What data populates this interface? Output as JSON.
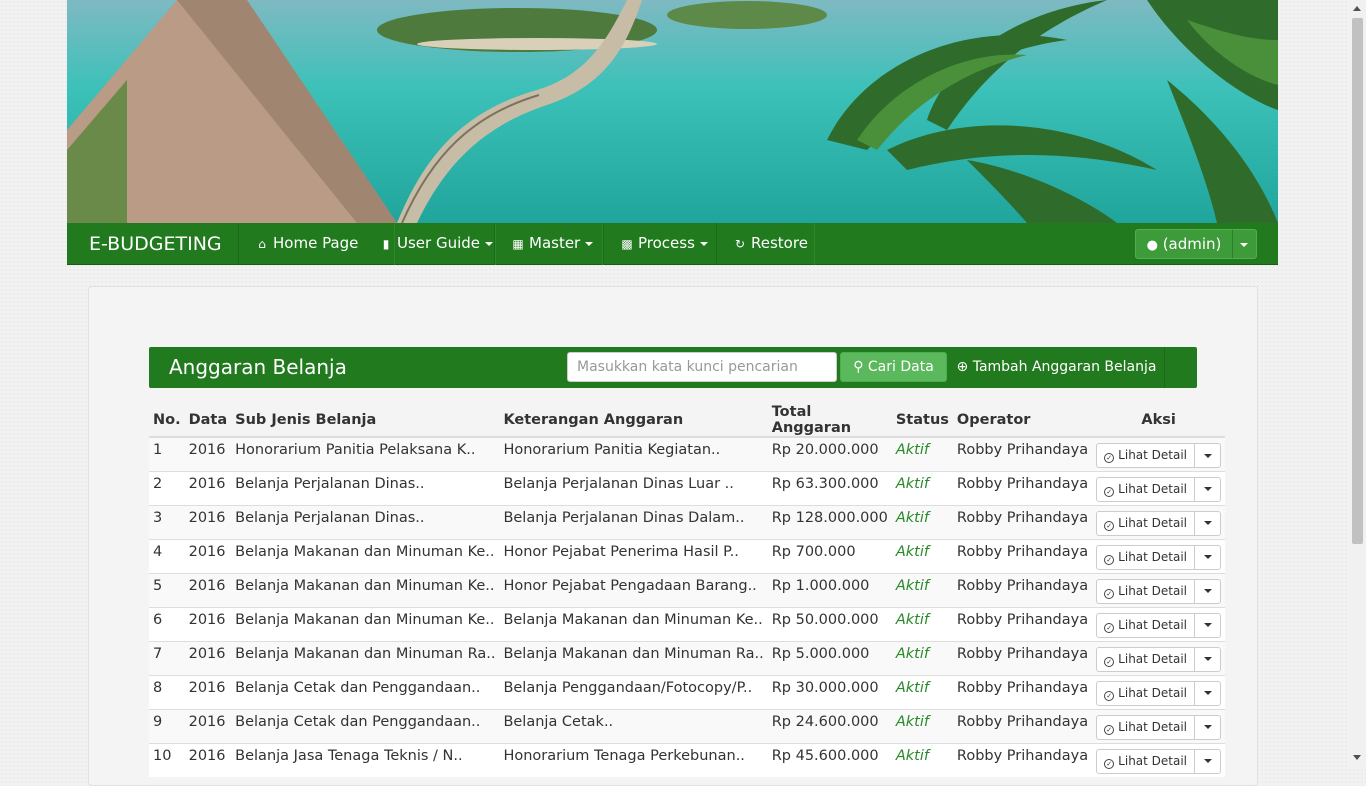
{
  "navbar": {
    "brand": "E-BUDGETING",
    "items": [
      {
        "label": "Home Page",
        "icon": "home-icon",
        "dropdown": false
      },
      {
        "label": "User Guide",
        "icon": "comment-icon",
        "dropdown": true
      },
      {
        "label": "Master",
        "icon": "th-icon",
        "dropdown": true
      },
      {
        "label": "Process",
        "icon": "th-large-icon",
        "dropdown": true
      },
      {
        "label": "Restore",
        "icon": "refresh-icon",
        "dropdown": false
      }
    ],
    "user_label": "(admin)"
  },
  "panel": {
    "title": "Anggaran Belanja",
    "search_placeholder": "Masukkan kata kunci pencarian",
    "search_button": "Cari Data",
    "add_button": "Tambah Anggaran Belanja"
  },
  "table": {
    "headers": [
      "No.",
      "Data",
      "Sub Jenis Belanja",
      "Keterangan Anggaran",
      "Total Anggaran",
      "Status",
      "Operator",
      "Aksi"
    ],
    "detail_label": "Lihat Detail",
    "rows": [
      {
        "no": "1",
        "data": "2016",
        "sub": "Honorarium Panitia Pelaksana K..",
        "ket": "Honorarium Panitia Kegiatan..",
        "total": "Rp 20.000.000",
        "status": "Aktif",
        "operator": "Robby Prihandaya"
      },
      {
        "no": "2",
        "data": "2016",
        "sub": "Belanja Perjalanan Dinas..",
        "ket": "Belanja Perjalanan Dinas Luar ..",
        "total": "Rp 63.300.000",
        "status": "Aktif",
        "operator": "Robby Prihandaya"
      },
      {
        "no": "3",
        "data": "2016",
        "sub": "Belanja Perjalanan Dinas..",
        "ket": "Belanja Perjalanan Dinas Dalam..",
        "total": "Rp 128.000.000",
        "status": "Aktif",
        "operator": "Robby Prihandaya"
      },
      {
        "no": "4",
        "data": "2016",
        "sub": "Belanja Makanan dan Minuman Ke..",
        "ket": "Honor Pejabat Penerima Hasil P..",
        "total": "Rp 700.000",
        "status": "Aktif",
        "operator": "Robby Prihandaya"
      },
      {
        "no": "5",
        "data": "2016",
        "sub": "Belanja Makanan dan Minuman Ke..",
        "ket": "Honor Pejabat Pengadaan Barang..",
        "total": "Rp 1.000.000",
        "status": "Aktif",
        "operator": "Robby Prihandaya"
      },
      {
        "no": "6",
        "data": "2016",
        "sub": "Belanja Makanan dan Minuman Ke..",
        "ket": "Belanja Makanan dan Minuman Ke..",
        "total": "Rp 50.000.000",
        "status": "Aktif",
        "operator": "Robby Prihandaya"
      },
      {
        "no": "7",
        "data": "2016",
        "sub": "Belanja Makanan dan Minuman Ra..",
        "ket": "Belanja Makanan dan Minuman Ra..",
        "total": "Rp 5.000.000",
        "status": "Aktif",
        "operator": "Robby Prihandaya"
      },
      {
        "no": "8",
        "data": "2016",
        "sub": "Belanja Cetak dan Penggandaan..",
        "ket": "Belanja Penggandaan/Fotocopy/P..",
        "total": "Rp 30.000.000",
        "status": "Aktif",
        "operator": "Robby Prihandaya"
      },
      {
        "no": "9",
        "data": "2016",
        "sub": "Belanja Cetak dan Penggandaan..",
        "ket": "Belanja Cetak..",
        "total": "Rp 24.600.000",
        "status": "Aktif",
        "operator": "Robby Prihandaya"
      },
      {
        "no": "10",
        "data": "2016",
        "sub": "Belanja Jasa Tenaga Teknis / N..",
        "ket": "Honorarium Tenaga Perkebunan..",
        "total": "Rp 45.600.000",
        "status": "Aktif",
        "operator": "Robby Prihandaya"
      }
    ]
  },
  "colors": {
    "navbar": "#217a1e",
    "search_button": "#5cb85c",
    "status_active": "#2a8a2a"
  }
}
